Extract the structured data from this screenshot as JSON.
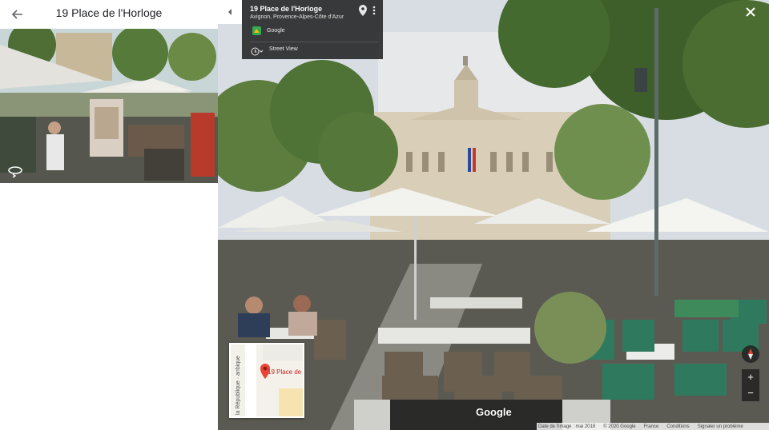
{
  "header": {
    "title": "19 Place de l'Horloge",
    "back_icon": "arrow-back-icon"
  },
  "info_card": {
    "title": "19 Place de l'Horloge",
    "subtitle": "Avignon, Provence-Alpes-Côte d'Azur",
    "provider": "Google",
    "mode": "Street View"
  },
  "minimap": {
    "place_label": "19 Place de",
    "road_label": "la République · anbique"
  },
  "brand": "Google",
  "footer": {
    "date": "Date de l'image : mai 2018",
    "copyright": "© 2020 Google",
    "country": "France",
    "terms": "Conditions",
    "report": "Signaler un problème"
  },
  "controls": {
    "zoom_in": "+",
    "zoom_out": "−"
  },
  "colors": {
    "card_bg": "#222222",
    "pin_red": "#ea4335",
    "umbrella": "#f2f2ee",
    "chairs_green": "#2f7a5f"
  }
}
